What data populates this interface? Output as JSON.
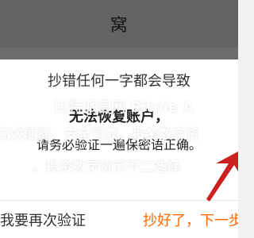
{
  "app": {
    "top_title": "窝"
  },
  "dialog": {
    "title": "抄错任何一字都会导致",
    "primary_line": "无法恢复账户，",
    "secondary_line": "请务必验证一遍保密语正确。",
    "left_button": "我要再次验证",
    "right_button": "抄好了，下一步"
  },
  "watermarks": {
    "brand": "比特派官网 Bitpie A",
    "line2": "高效便捷、安全可靠，投资数字货",
    "line3": "，投资数字货币不二选择"
  },
  "colors": {
    "accent": "#ff6a00",
    "arrow": "#cc1f1f"
  }
}
